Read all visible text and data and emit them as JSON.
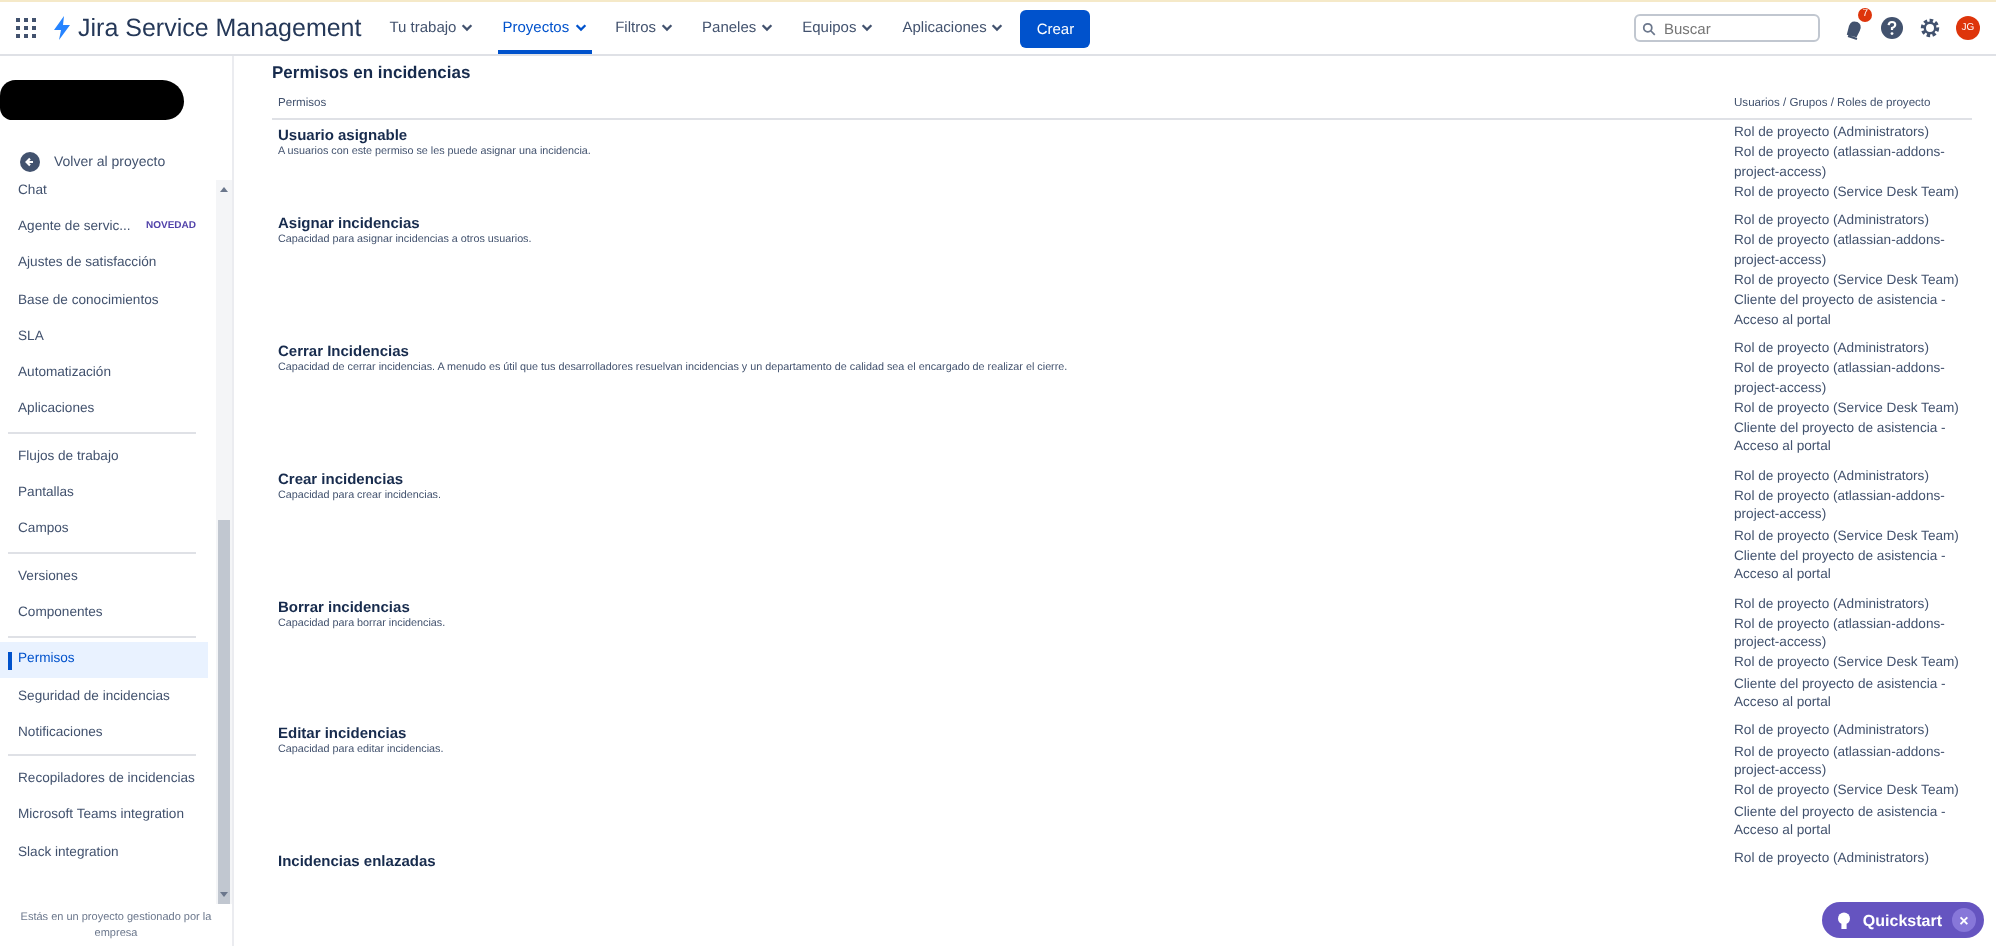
{
  "topbar": {
    "product": "Jira Service Management",
    "nav": [
      {
        "label": "Tu trabajo",
        "selected": false
      },
      {
        "label": "Proyectos",
        "selected": true
      },
      {
        "label": "Filtros",
        "selected": false
      },
      {
        "label": "Paneles",
        "selected": false
      },
      {
        "label": "Equipos",
        "selected": false
      },
      {
        "label": "Aplicaciones",
        "selected": false
      }
    ],
    "create_button": "Crear",
    "search": {
      "placeholder": "Buscar"
    },
    "notification_count": "7",
    "avatar": "JG"
  },
  "sidebar": {
    "back_link": "Volver al proyecto",
    "groups": [
      [
        {
          "label": "Chat",
          "selected": false
        },
        {
          "label": "Agente de servic...",
          "badge": "NOVEDAD",
          "selected": false
        },
        {
          "label": "Ajustes de satisfacción",
          "selected": false
        },
        {
          "label": "Base de conocimientos",
          "selected": false
        },
        {
          "label": "SLA",
          "selected": false
        },
        {
          "label": "Automatización",
          "selected": false
        },
        {
          "label": "Aplicaciones",
          "selected": false
        }
      ],
      [
        {
          "label": "Flujos de trabajo",
          "selected": false
        },
        {
          "label": "Pantallas",
          "selected": false
        },
        {
          "label": "Campos",
          "selected": false
        }
      ],
      [
        {
          "label": "Versiones",
          "selected": false
        },
        {
          "label": "Componentes",
          "selected": false
        }
      ],
      [
        {
          "label": "Permisos",
          "selected": true
        },
        {
          "label": "Seguridad de incidencias",
          "selected": false
        },
        {
          "label": "Notificaciones",
          "selected": false
        }
      ],
      [
        {
          "label": "Recopiladores de incidencias",
          "selected": false
        },
        {
          "label": "Microsoft Teams integration",
          "selected": false
        },
        {
          "label": "Slack integration",
          "selected": false
        }
      ]
    ],
    "footer": "Estás en un proyecto gestionado por la empresa"
  },
  "section_title": "Permisos en incidencias",
  "table": {
    "columns": [
      "Permisos",
      "Usuarios / Grupos / Roles de proyecto"
    ],
    "rows": [
      {
        "name": "Usuario asignable",
        "description": "A usuarios con este permiso se les puede asignar una incidencia.",
        "roles": [
          "Rol de proyecto (Administrators)",
          "Rol de proyecto (atlassian-addons-project-access)",
          "Rol de proyecto (Service Desk Team)"
        ]
      },
      {
        "name": "Asignar incidencias",
        "description": "Capacidad para asignar incidencias a otros usuarios.",
        "roles": [
          "Rol de proyecto (Administrators)",
          "Rol de proyecto (atlassian-addons-project-access)",
          "Rol de proyecto (Service Desk Team)",
          "Cliente del proyecto de asistencia - Acceso al portal"
        ]
      },
      {
        "name": "Cerrar Incidencias",
        "description": "Capacidad de cerrar incidencias. A menudo es útil que tus desarrolladores resuelvan incidencias y un departamento de calidad sea el encargado de realizar el cierre.",
        "roles": [
          "Rol de proyecto (Administrators)",
          "Rol de proyecto (atlassian-addons-project-access)",
          "Rol de proyecto (Service Desk Team)",
          "Cliente del proyecto de asistencia - Acceso al portal"
        ]
      },
      {
        "name": "Crear incidencias",
        "description": "Capacidad para crear incidencias.",
        "roles": [
          "Rol de proyecto (Administrators)",
          "Rol de proyecto (atlassian-addons-project-access)",
          "Rol de proyecto (Service Desk Team)",
          "Cliente del proyecto de asistencia - Acceso al portal"
        ]
      },
      {
        "name": "Borrar incidencias",
        "description": "Capacidad para borrar incidencias.",
        "roles": [
          "Rol de proyecto (Administrators)",
          "Rol de proyecto (atlassian-addons-project-access)",
          "Rol de proyecto (Service Desk Team)",
          "Cliente del proyecto de asistencia - Acceso al portal"
        ]
      },
      {
        "name": "Editar incidencias",
        "description": "Capacidad para editar incidencias.",
        "roles": [
          "Rol de proyecto (Administrators)",
          "Rol de proyecto (atlassian-addons-project-access)",
          "Rol de proyecto (Service Desk Team)",
          "Cliente del proyecto de asistencia - Acceso al portal"
        ]
      },
      {
        "name": "Incidencias enlazadas",
        "roles": [
          "Rol de proyecto (Administrators)"
        ]
      }
    ]
  },
  "quickstart": {
    "label": "Quickstart",
    "close": "×"
  }
}
